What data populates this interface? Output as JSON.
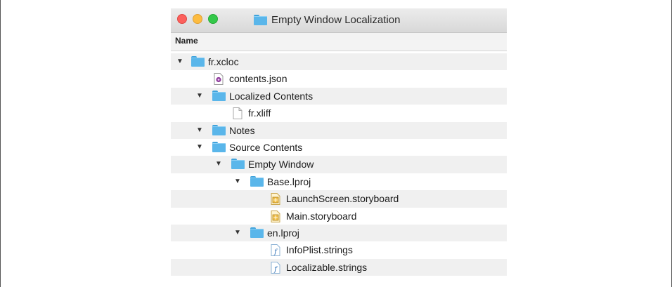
{
  "window": {
    "title": "Empty Window Localization",
    "column_header": "Name"
  },
  "colors": {
    "folder": "#5ab6ea",
    "close": "#fc605c",
    "minimize": "#fdbc40",
    "maximize": "#34c84a"
  },
  "tree": [
    {
      "label": "fr.xcloc",
      "icon": "folder-icon",
      "expanded": true
    },
    {
      "label": "contents.json",
      "icon": "json-file-icon"
    },
    {
      "label": "Localized Contents",
      "icon": "folder-icon",
      "expanded": true
    },
    {
      "label": "fr.xliff",
      "icon": "file-icon"
    },
    {
      "label": "Notes",
      "icon": "folder-icon",
      "expanded": true
    },
    {
      "label": "Source Contents",
      "icon": "folder-icon",
      "expanded": true
    },
    {
      "label": "Empty Window",
      "icon": "folder-icon",
      "expanded": true
    },
    {
      "label": "Base.lproj",
      "icon": "folder-icon",
      "expanded": true
    },
    {
      "label": "LaunchScreen.storyboard",
      "icon": "storyboard-file-icon"
    },
    {
      "label": "Main.storyboard",
      "icon": "storyboard-file-icon"
    },
    {
      "label": "en.lproj",
      "icon": "folder-icon",
      "expanded": true
    },
    {
      "label": "InfoPlist.strings",
      "icon": "strings-file-icon"
    },
    {
      "label": "Localizable.strings",
      "icon": "strings-file-icon"
    }
  ]
}
